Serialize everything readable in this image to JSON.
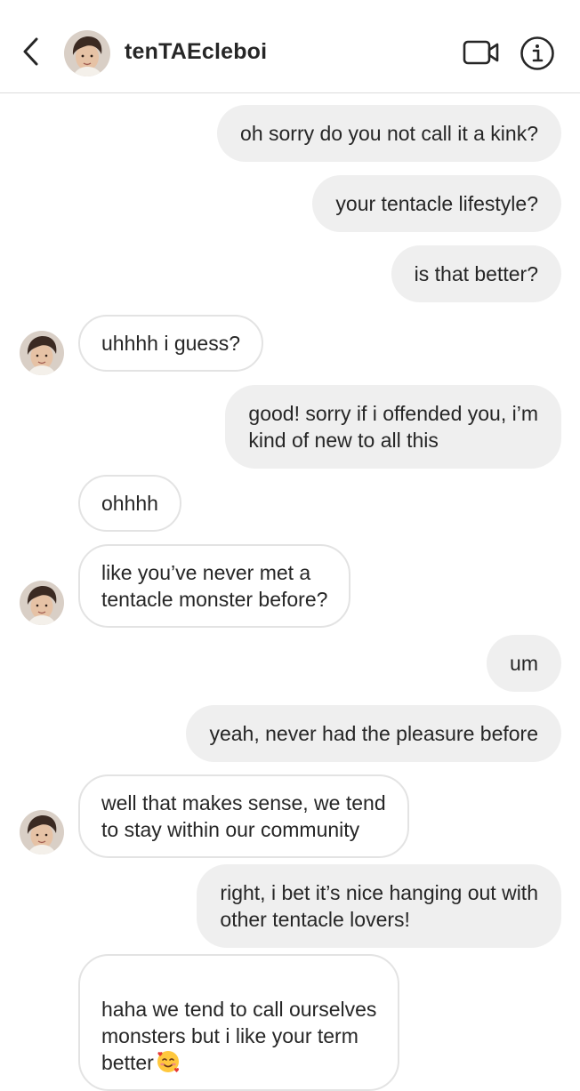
{
  "header": {
    "username": "tenTAEcleboi",
    "back_icon": "chevron-left-icon",
    "video_icon": "video-camera-icon",
    "info_icon": "info-icon"
  },
  "messages": [
    {
      "dir": "out",
      "text": "oh sorry do you not call it a kink?"
    },
    {
      "dir": "out",
      "text": "your tentacle lifestyle?"
    },
    {
      "dir": "out",
      "text": "is that better?"
    },
    {
      "dir": "in",
      "text": "uhhhh i guess?"
    },
    {
      "dir": "out",
      "text": "good! sorry if i offended you, i’m\nkind of new to all this"
    },
    {
      "dir": "in",
      "text": "ohhhh"
    },
    {
      "dir": "in",
      "text": "like you’ve never met a\ntentacle monster before?"
    },
    {
      "dir": "out",
      "text": "um"
    },
    {
      "dir": "out",
      "text": "yeah, never had the pleasure before"
    },
    {
      "dir": "in",
      "text": "well that makes sense, we tend\nto stay within our community"
    },
    {
      "dir": "out",
      "text": "right, i bet it’s nice hanging out with\nother tentacle lovers!"
    },
    {
      "dir": "in",
      "text": "haha we tend to call ourselves\nmonsters but i like your term\nbetter",
      "emoji": "smiling-face-with-hearts-icon"
    }
  ]
}
